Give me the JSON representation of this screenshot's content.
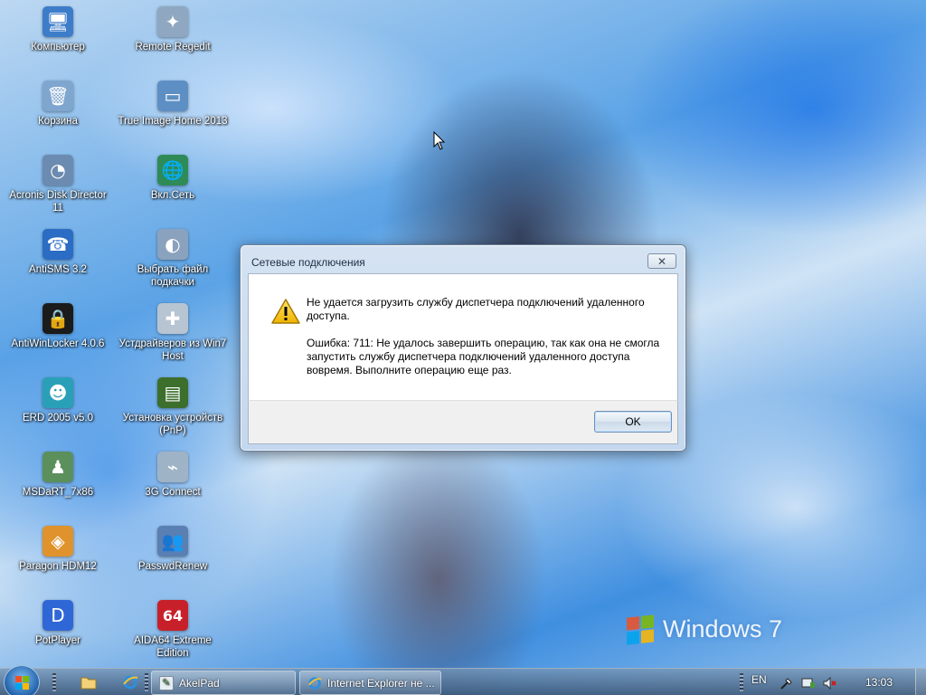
{
  "desktop": {
    "icons": [
      {
        "label": "Компьютер",
        "icon": "computer-icon",
        "glyph": "🖥",
        "color": "#3d7cc9"
      },
      {
        "label": "Remote Regedit",
        "icon": "regedit-icon",
        "glyph": "✦",
        "color": "#8fa7c0"
      },
      {
        "label": "Корзина",
        "icon": "recycle-bin-icon",
        "glyph": "🗑",
        "color": "#7fa6cf"
      },
      {
        "label": "True Image Home 2013",
        "icon": "true-image-icon",
        "glyph": "▭",
        "color": "#5d8fc4"
      },
      {
        "label": "Acronis Disk Director 11",
        "icon": "disk-director-icon",
        "glyph": "◔",
        "color": "#6c8bb0"
      },
      {
        "label": "Вкл.Сеть",
        "icon": "network-globe-icon",
        "glyph": "🌐",
        "color": "#2e8b57"
      },
      {
        "label": "AntiSMS 3.2",
        "icon": "antisms-icon",
        "glyph": "☎",
        "color": "#2b6cc4"
      },
      {
        "label": "Выбрать файл подкачки",
        "icon": "pagefile-icon",
        "glyph": "◐",
        "color": "#8aa2bd"
      },
      {
        "label": "AntiWinLocker 4.0.6",
        "icon": "lock-icon",
        "glyph": "🔒",
        "color": "#1b1b1b"
      },
      {
        "label": "Устдрайверов из Win7 Host",
        "icon": "driver-install-icon",
        "glyph": "✚",
        "color": "#b7c4d2"
      },
      {
        "label": "ERD 2005 v5.0",
        "icon": "erd-icon",
        "glyph": "☻",
        "color": "#2aa0b8"
      },
      {
        "label": "Установка устройств (PnP)",
        "icon": "memory-chip-icon",
        "glyph": "▤",
        "color": "#3c6e2c"
      },
      {
        "label": "MSDaRT_7x86",
        "icon": "msdart-icon",
        "glyph": "♟",
        "color": "#5b8f5b"
      },
      {
        "label": "3G Connect",
        "icon": "usb-modem-icon",
        "glyph": "⌁",
        "color": "#9fb3c7"
      },
      {
        "label": "Paragon HDM12",
        "icon": "paragon-icon",
        "glyph": "◈",
        "color": "#e0932c"
      },
      {
        "label": "PasswdRenew",
        "icon": "users-icon",
        "glyph": "👥",
        "color": "#5a7fb2"
      },
      {
        "label": "PotPlayer",
        "icon": "potplayer-icon",
        "glyph": "D",
        "color": "#2f67d6"
      },
      {
        "label": "AIDA64 Extreme Edition",
        "icon": "aida64-icon",
        "glyph": "64",
        "color": "#c8202a"
      }
    ],
    "wallpaper_logo": "Windows 7"
  },
  "dialog": {
    "title": "Сетевые подключения",
    "close_label": "✕",
    "message_1": "Не удается загрузить службу диспетчера подключений удаленного доступа.",
    "message_2": "Ошибка: 711: Не удалось завершить операцию, так как она не смогла запустить службу диспетчера подключений удаленного доступа вовремя. Выполните операцию еще раз.",
    "ok_label": "OK"
  },
  "taskbar": {
    "buttons": [
      {
        "label": "AkelPad",
        "icon": "notepad-icon"
      },
      {
        "label": "Internet Explorer не ...",
        "icon": "internet-explorer-icon"
      }
    ],
    "language": "EN",
    "clock": "13:03"
  }
}
